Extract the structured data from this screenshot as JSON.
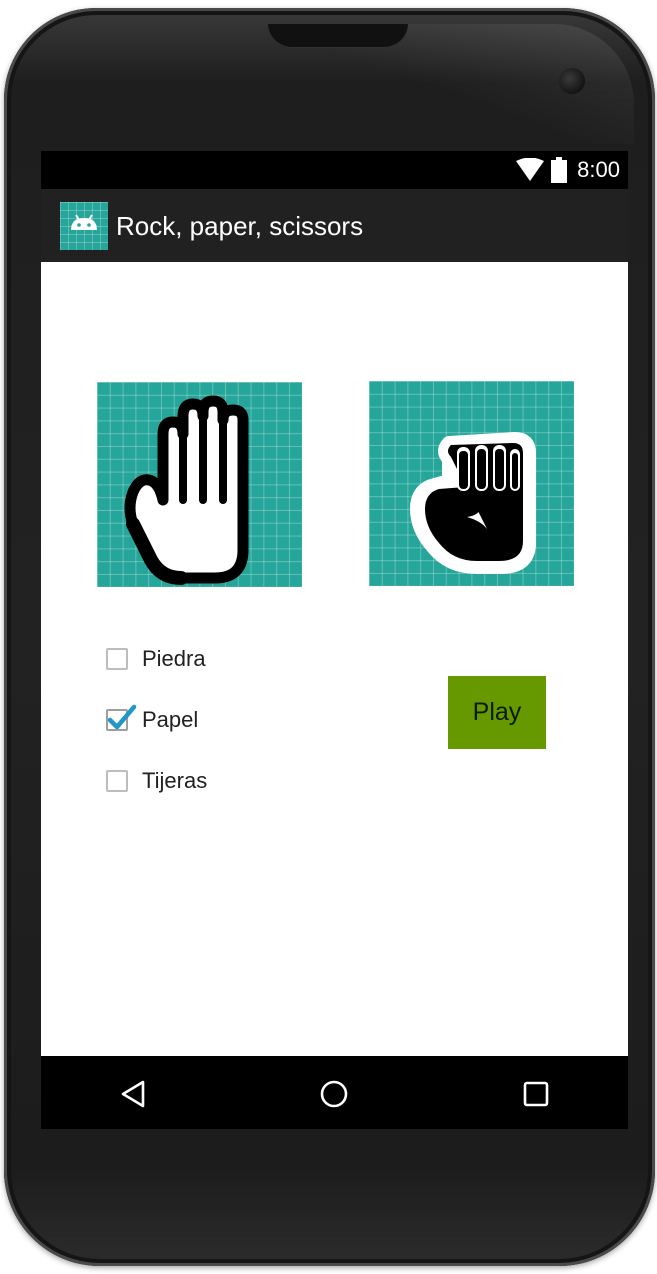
{
  "status_bar": {
    "time": "8:00",
    "icons": [
      "wifi-icon",
      "battery-icon"
    ]
  },
  "app_bar": {
    "title": "Rock, paper, scissors",
    "icon": "android-icon"
  },
  "images": {
    "player": "open-hand-paper-icon",
    "opponent": "fist-rock-icon"
  },
  "options": [
    {
      "label": "Piedra",
      "checked": false
    },
    {
      "label": "Papel",
      "checked": true
    },
    {
      "label": "Tijeras",
      "checked": false
    }
  ],
  "play_button": {
    "label": "Play"
  },
  "nav_bar": {
    "buttons": [
      "back-icon",
      "home-icon",
      "recents-icon"
    ]
  },
  "colors": {
    "accent": "#669900",
    "image_background": "#26a69a",
    "checkbox_tick": "#2196c9",
    "app_bar": "#212121"
  }
}
